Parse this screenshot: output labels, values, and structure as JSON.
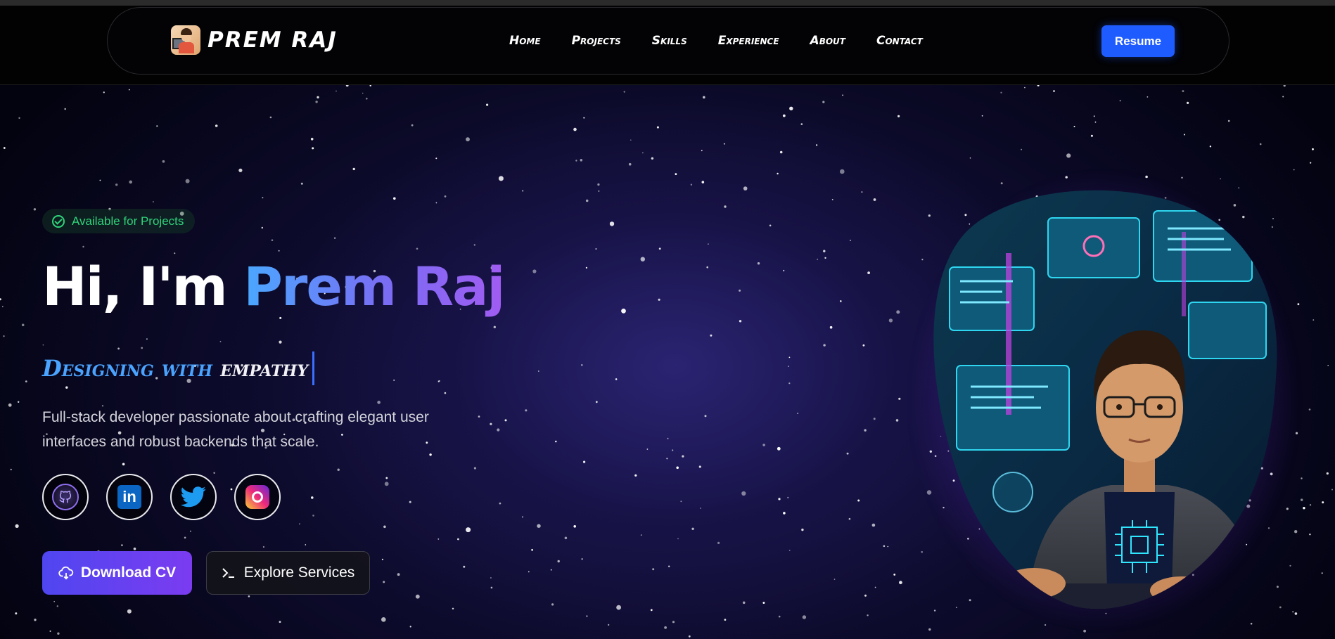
{
  "brand": {
    "name": "PREM RAJ",
    "logo_icon": "developer-avatar-icon"
  },
  "nav": {
    "links": [
      "Home",
      "Projects",
      "Skills",
      "Experience",
      "About",
      "Contact"
    ],
    "resume_label": "Resume"
  },
  "hero": {
    "badge": "Available for Projects",
    "title_prefix": "Hi, I'm ",
    "title_name": "Prem Raj",
    "tagline_part1": "Designing with",
    "tagline_part2": "empathy",
    "description": "Full-stack developer passionate about crafting elegant user interfaces and robust backends that scale.",
    "socials": [
      "github-icon",
      "linkedin-icon",
      "twitter-icon",
      "instagram-icon"
    ],
    "primary_button": "Download CV",
    "secondary_button": "Explore Services"
  },
  "colors": {
    "accent_blue": "#1f5cff",
    "gradient_start": "#4aa8ff",
    "gradient_end": "#a15cf2",
    "badge_green": "#2fd47a",
    "button_purple": "#6a3ff0"
  }
}
